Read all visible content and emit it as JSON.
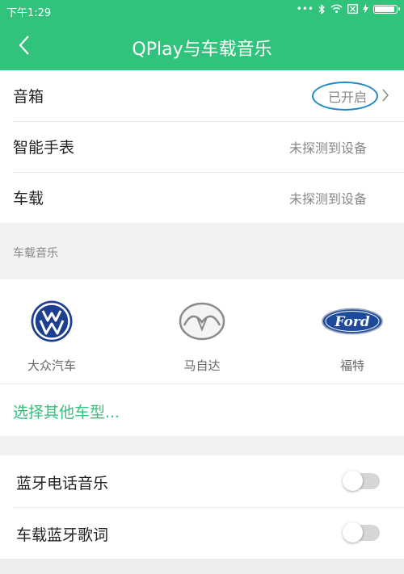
{
  "status_bar": {
    "time": "下午1:29",
    "icons": [
      "more-dots-icon",
      "bluetooth-icon",
      "wifi-icon",
      "sim-off-icon",
      "charging-icon",
      "battery-icon"
    ]
  },
  "header": {
    "title": "QPlay与车载音乐",
    "back_icon": "back-arrow-icon",
    "background_color": "#31c27c"
  },
  "devices": [
    {
      "label": "音箱",
      "value": "已开启",
      "highlighted": true
    },
    {
      "label": "智能手表",
      "value": "未探测到设备"
    },
    {
      "label": "车载",
      "value": "未探测到设备"
    }
  ],
  "car_music": {
    "section_title": "车载音乐",
    "brands": [
      {
        "label": "大众汽车",
        "icon": "volkswagen-logo-icon"
      },
      {
        "label": "马自达",
        "icon": "mazda-logo-icon"
      },
      {
        "label": "福特",
        "icon": "ford-logo-icon",
        "logo_text": "Ford"
      }
    ],
    "other_link": "选择其他车型..."
  },
  "toggles": [
    {
      "label": "蓝牙电话音乐",
      "on": false
    },
    {
      "label": "车载蓝牙歌词",
      "on": false
    }
  ],
  "colors": {
    "accent": "#31c27c",
    "highlight_ring": "#1e88c8"
  }
}
